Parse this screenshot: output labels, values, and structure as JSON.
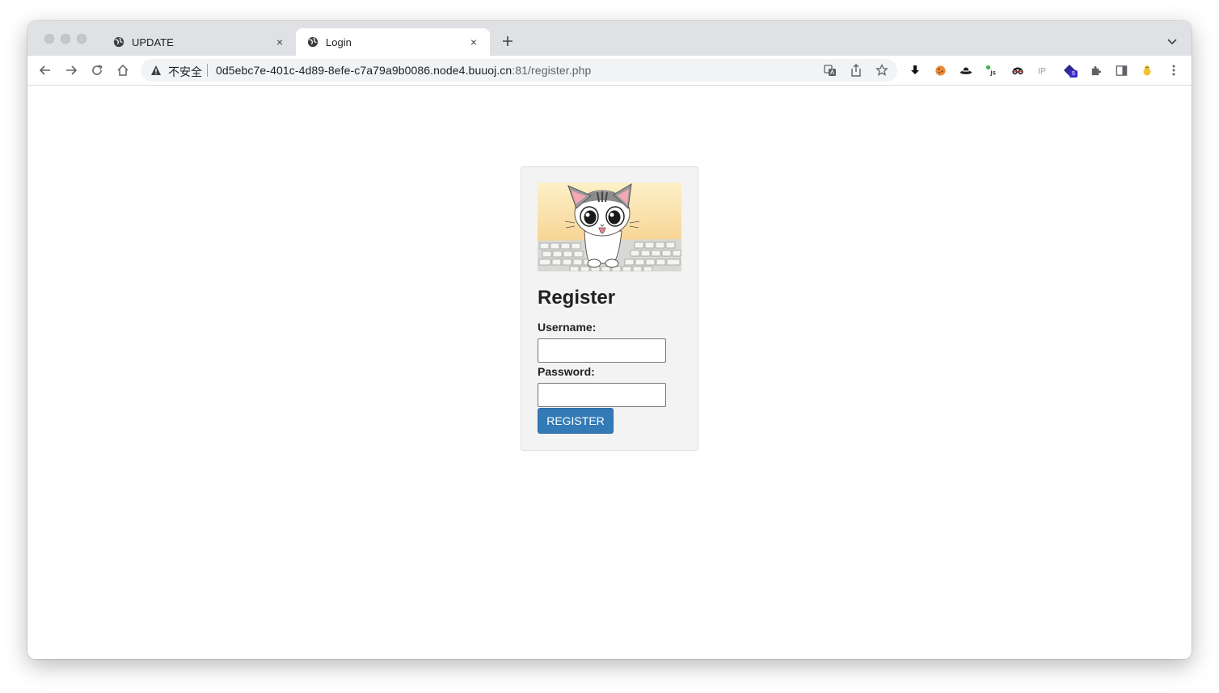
{
  "browser": {
    "tabs": [
      {
        "title": "UPDATE",
        "icon": "globe-icon",
        "active": false
      },
      {
        "title": "Login",
        "icon": "globe-icon",
        "active": true
      }
    ],
    "close_glyph": "×",
    "new_tab_icon": "plus-icon",
    "address": {
      "security_label": "不安全",
      "host": "0d5ebc7e-401c-4d89-8efe-c7a79a9b0086.node4.buuoj.cn",
      "path": ":81/register.php"
    },
    "extension_badge": "5"
  },
  "page": {
    "title": "Register",
    "username_label": "Username:",
    "password_label": "Password:",
    "username_value": "",
    "password_value": "",
    "submit_label": "REGISTER",
    "hero_image": "cat-on-keyboard"
  },
  "colors": {
    "primary_button": "#337ab7",
    "card_background": "#f3f3f3",
    "tabstrip_background": "#dfe1e5"
  }
}
